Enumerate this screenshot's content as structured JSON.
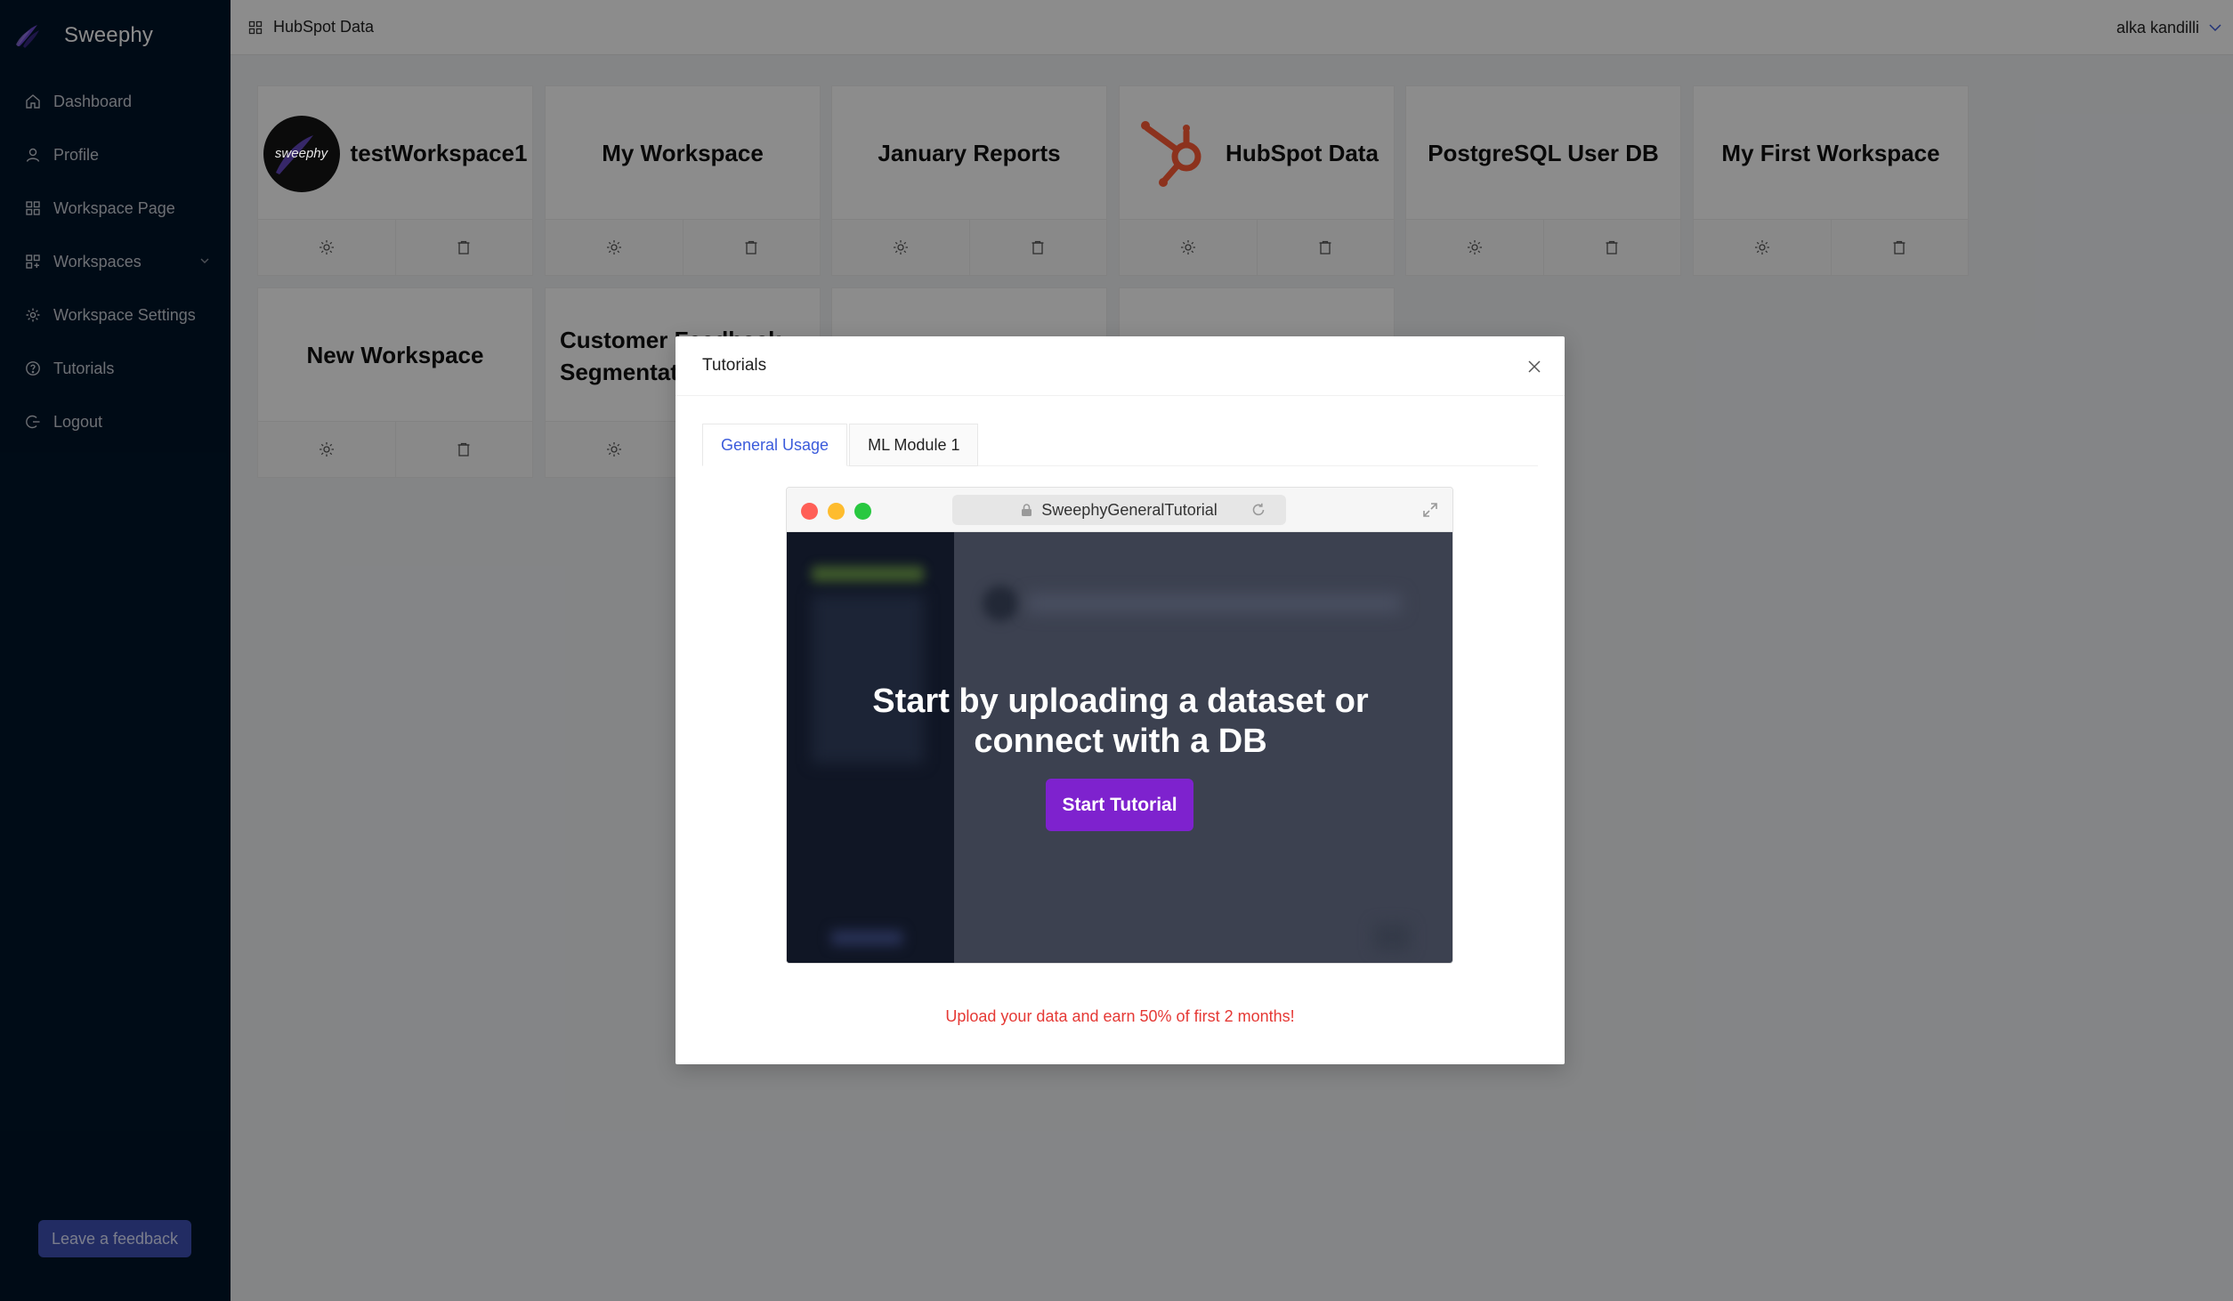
{
  "app": {
    "name": "Sweephy"
  },
  "sidebar": {
    "items": [
      {
        "label": "Dashboard",
        "icon": "home-icon"
      },
      {
        "label": "Profile",
        "icon": "user-icon"
      },
      {
        "label": "Workspace Page",
        "icon": "grid-icon"
      },
      {
        "label": "Workspaces",
        "icon": "apps-icon",
        "has_submenu": true
      },
      {
        "label": "Workspace Settings",
        "icon": "gear-icon"
      },
      {
        "label": "Tutorials",
        "icon": "question-circle-icon"
      },
      {
        "label": "Logout",
        "icon": "logout-icon"
      }
    ],
    "feedback_label": "Leave a feedback"
  },
  "header": {
    "breadcrumb": "HubSpot Data",
    "user_name": "alka kandilli"
  },
  "workspaces": [
    {
      "title": "testWorkspace1",
      "avatar_text": "sweephy"
    },
    {
      "title": "My Workspace"
    },
    {
      "title": "January Reports"
    },
    {
      "title": "HubSpot Data",
      "logo": "hubspot-logo"
    },
    {
      "title": "PostgreSQL User DB"
    },
    {
      "title": "My First Workspace"
    },
    {
      "title": "New Workspace"
    },
    {
      "title": "Customer Feedback Segmentation",
      "visible_title": "Customer F... Segmentati..."
    }
  ],
  "modal": {
    "title": "Tutorials",
    "tabs": [
      {
        "label": "General Usage",
        "active": true
      },
      {
        "label": "ML Module 1",
        "active": false
      }
    ],
    "browser": {
      "url": "SweephyGeneralTutorial",
      "headline_line1": "Start by uploading a dataset or",
      "headline_line2": "connect with a DB",
      "button_label": "Start Tutorial"
    },
    "promo": "Upload your data and earn 50% of first 2 months!"
  },
  "colors": {
    "sidebar_bg": "#001529",
    "accent": "#3b5bdb",
    "feedback_button": "#3f51b5",
    "tutorial_button": "#7e22ce",
    "promo_text": "#e53935",
    "hubspot_orange": "#ff5c35"
  }
}
